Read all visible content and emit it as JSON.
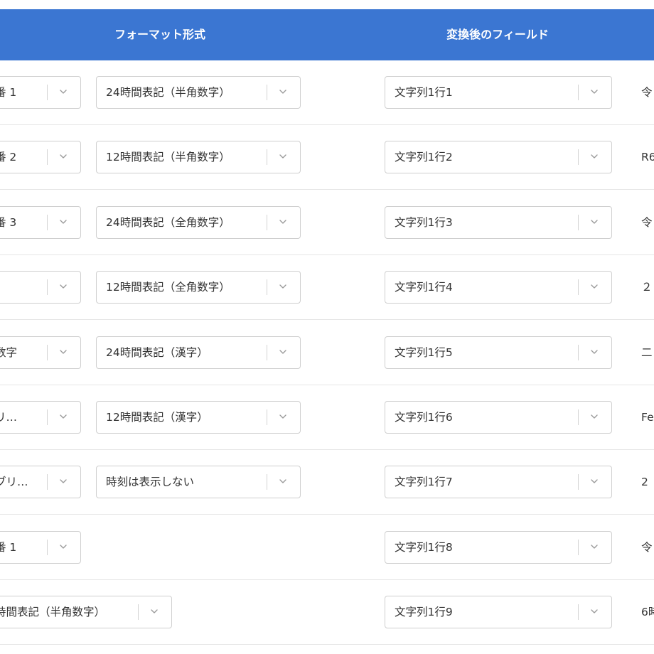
{
  "header": {
    "format_label": "フォーマット形式",
    "after_label": "変換後のフィールド"
  },
  "rows": [
    {
      "left": "番 1",
      "format": "24時間表記（半角数字）",
      "field": "文字列1行1",
      "preview": "令"
    },
    {
      "left": "番 2",
      "format": "12時間表記（半角数字）",
      "field": "文字列1行2",
      "preview": "R6"
    },
    {
      "left": "番 3",
      "format": "24時間表記（全角数字）",
      "field": "文字列1行3",
      "preview": "令"
    },
    {
      "left": "",
      "format": "12時間表記（全角数字）",
      "field": "文字列1行4",
      "preview": "２"
    },
    {
      "left": "数字",
      "format": "24時間表記（漢字）",
      "field": "文字列1行5",
      "preview": "二"
    },
    {
      "left": "リ…",
      "format": "12時間表記（漢字）",
      "field": "文字列1行6",
      "preview": "Fe"
    },
    {
      "left": "ブリ…",
      "format": "時刻は表示しない",
      "field": "文字列1行7",
      "preview": "2 "
    },
    {
      "left": "番 1",
      "format": null,
      "field": "文字列1行8",
      "preview": "令"
    },
    {
      "wide": "時間表記（半角数字）",
      "field": "文字列1行9",
      "preview": "6時"
    }
  ],
  "icons": {
    "dropdown": "chevron-down-icon"
  },
  "colors": {
    "header_bg": "#3b76d2",
    "header_text": "#ffffff",
    "border": "#cfcfcf"
  }
}
